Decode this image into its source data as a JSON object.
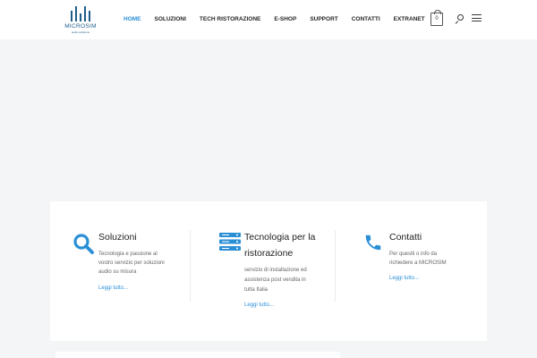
{
  "header": {
    "logo": {
      "text": "MICROSIM",
      "subtext": "audio solutions"
    },
    "nav": [
      {
        "label": "HOME",
        "active": true
      },
      {
        "label": "SOLUZIONI",
        "active": false
      },
      {
        "label": "TECH RISTORAZIONE",
        "active": false
      },
      {
        "label": "E-SHOP",
        "active": false
      },
      {
        "label": "SUPPORT",
        "active": false
      },
      {
        "label": "CONTATTI",
        "active": false
      },
      {
        "label": "EXTRANET",
        "active": false
      }
    ],
    "cart_count": "0",
    "icons": [
      "shopping-bag-icon",
      "search-icon",
      "menu-waves-icon"
    ]
  },
  "features": [
    {
      "icon": "search-icon",
      "title": "Soluzioni",
      "text": [
        "Tecnologia e passione al",
        "vostro servizio per soluzioni",
        "audio su misura"
      ],
      "link": "Leggi tutto..."
    },
    {
      "icon": "server-icon",
      "title": [
        "Tecnologia per la",
        "ristorazione"
      ],
      "text": [
        "servizio di installazione ed",
        "assistenza post vendita in",
        "tutta Italia"
      ],
      "link": "Leggi tutto..."
    },
    {
      "icon": "phone-icon",
      "title": "Contatti",
      "text": [
        "Per quesiti o info da",
        "richiedere a MICROSIM"
      ],
      "link": "Leggi tutto..."
    }
  ],
  "colors": {
    "accent": "#2b8fd6",
    "logo": "#1f5d8a",
    "background": "#f4f5f7"
  }
}
